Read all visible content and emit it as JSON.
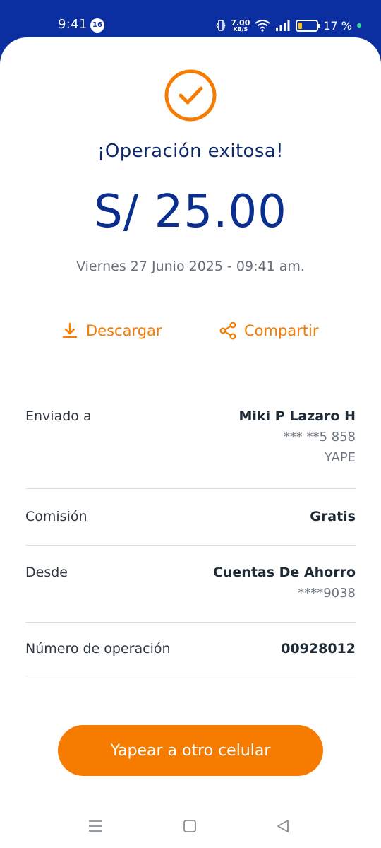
{
  "status_bar": {
    "time": "9:41",
    "notification_count": "16",
    "net_speed_value": "7.00",
    "net_speed_unit": "KB/S",
    "battery_percent": "17 %",
    "battery_level": 0.17
  },
  "receipt": {
    "title": "¡Operación exitosa!",
    "amount": "S/ 25.00",
    "datetime": "Viernes 27 Junio 2025 - 09:41 am."
  },
  "actions": {
    "download_label": "Descargar",
    "share_label": "Compartir"
  },
  "details": {
    "sent_to": {
      "label": "Enviado a",
      "name": "Miki P Lazaro H",
      "phone": "*** **5 858",
      "method": "YAPE"
    },
    "commission": {
      "label": "Comisión",
      "value": "Gratis"
    },
    "from": {
      "label": "Desde",
      "account": "Cuentas De Ahorro",
      "number": "****9038"
    },
    "operation_number": {
      "label": "Número de operación",
      "value": "00928012"
    }
  },
  "cta": {
    "label": "Yapear a otro celular"
  },
  "colors": {
    "brand_blue": "#0b2fa0",
    "accent_orange": "#f57c00"
  }
}
